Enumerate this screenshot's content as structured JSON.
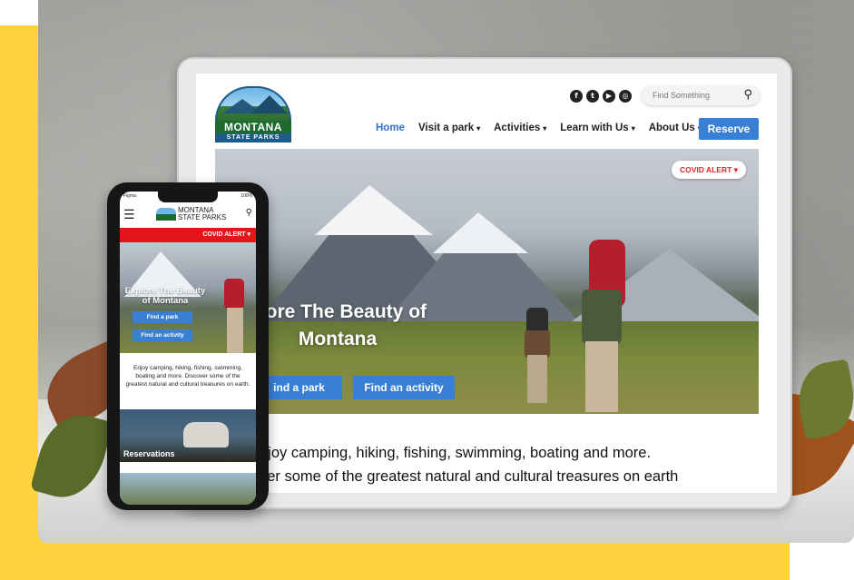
{
  "site": {
    "logo": {
      "line1": "MONTANA",
      "line2": "STATE PARKS"
    },
    "social": [
      "f",
      "t",
      "▶",
      "◎"
    ],
    "search": {
      "placeholder": "Find Something"
    },
    "nav": [
      {
        "label": "Home",
        "active": true,
        "dropdown": false
      },
      {
        "label": "Visit a park",
        "active": false,
        "dropdown": true
      },
      {
        "label": "Activities",
        "active": false,
        "dropdown": true
      },
      {
        "label": "Learn with Us",
        "active": false,
        "dropdown": true
      },
      {
        "label": "About Us",
        "active": false,
        "dropdown": true
      }
    ],
    "reserve_label": "Reserve",
    "covid_label": "COVID ALERT",
    "hero_title_1": "plore The Beauty of",
    "hero_title_2": "Montana",
    "hero_btn_1": "ind a park",
    "hero_btn_2": "Find an activity",
    "desc_1": "njoy camping, hiking, fishing, swimming, boating and more.",
    "desc_2": "ver some of the greatest natural and cultural treasures on earth"
  },
  "mobile": {
    "status_left": "Figma",
    "status_right": "100%",
    "logo_text_1": "MONTANA",
    "logo_text_2": "STATE PARKS",
    "covid_label": "COVID ALERT",
    "hero_title": "Explore The Beauty of Montana",
    "btn_1": "Find a park",
    "btn_2": "Find an activity",
    "desc": "Enjoy camping, hiking, fishing, swimming, boating and more. Discover some of the greatest natural and cultural treasures on earth.",
    "card_label": "Reservations"
  },
  "colors": {
    "accent": "#3a7fd6",
    "alert": "#e5161b",
    "background_block": "#FFD23F"
  }
}
